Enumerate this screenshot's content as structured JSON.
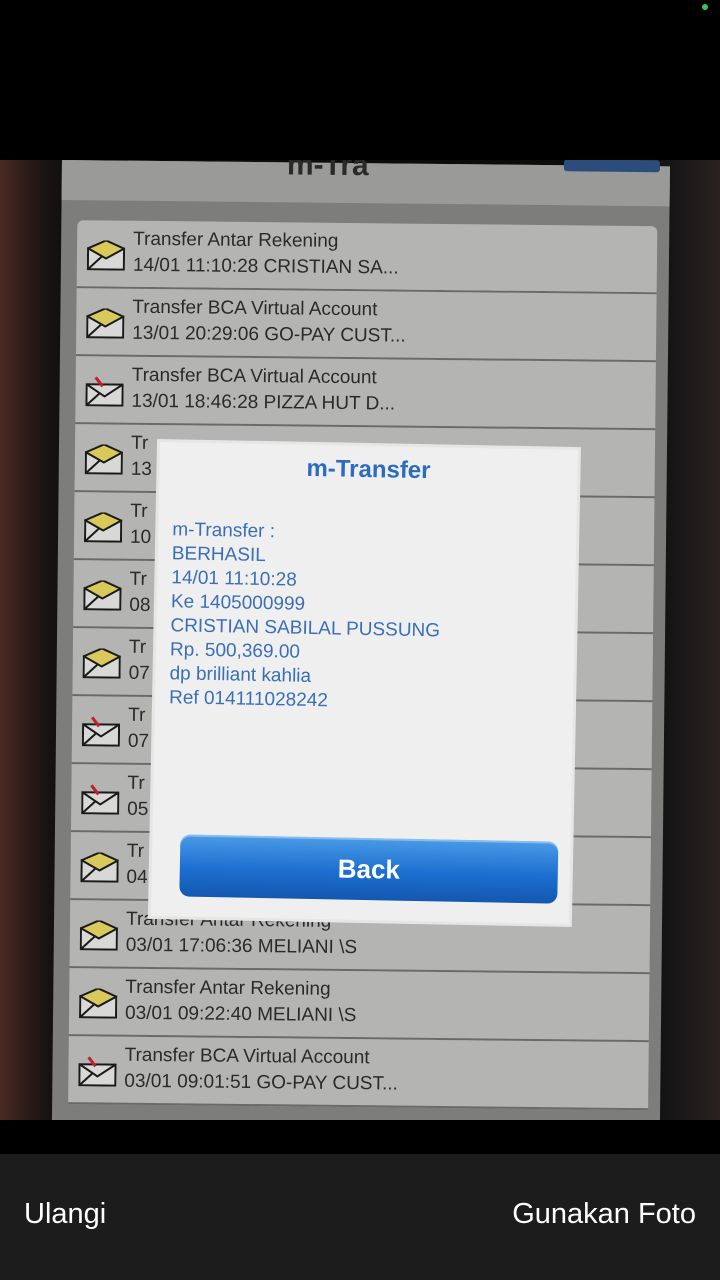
{
  "status": {
    "dot_color": "#34c759"
  },
  "photo": {
    "screen_header_title": "m-Tra",
    "messages": [
      {
        "title": "Transfer Antar Rekening",
        "subtitle": "14/01 11:10:28 CRISTIAN SA...",
        "icon": "envelope-closed-icon"
      },
      {
        "title": "Transfer BCA Virtual Account",
        "subtitle": "13/01 20:29:06 GO-PAY CUST...",
        "icon": "envelope-closed-icon"
      },
      {
        "title": "Transfer BCA Virtual Account",
        "subtitle": "13/01 18:46:28 PIZZA HUT D...",
        "icon": "envelope-open-icon"
      },
      {
        "title": "Tr",
        "subtitle": "13",
        "icon": "envelope-closed-icon"
      },
      {
        "title": "Tr",
        "subtitle": "10",
        "icon": "envelope-closed-icon"
      },
      {
        "title": "Tr",
        "subtitle": "08",
        "icon": "envelope-closed-icon"
      },
      {
        "title": "Tr",
        "subtitle": "07",
        "icon": "envelope-closed-icon"
      },
      {
        "title": "Tr",
        "subtitle": "07",
        "icon": "envelope-open-icon"
      },
      {
        "title": "Tr",
        "subtitle": "05",
        "icon": "envelope-open-icon"
      },
      {
        "title": "Tr",
        "subtitle": "04",
        "icon": "envelope-closed-icon"
      },
      {
        "title": "Transfer Antar Rekening",
        "subtitle": "03/01 17:06:36 MELIANI \\S",
        "icon": "envelope-closed-icon"
      },
      {
        "title": "Transfer Antar Rekening",
        "subtitle": "03/01 09:22:40 MELIANI \\S",
        "icon": "envelope-closed-icon"
      },
      {
        "title": "Transfer BCA Virtual Account",
        "subtitle": "03/01 09:01:51 GO-PAY CUST...",
        "icon": "envelope-open-icon"
      }
    ],
    "dialog": {
      "title": "m-Transfer",
      "lines": [
        "m-Transfer :",
        "BERHASIL",
        "14/01 11:10:28",
        "Ke 1405000999",
        "CRISTIAN SABILAL PUSSUNG",
        "Rp. 500,369.00",
        "dp brilliant kahlia",
        "Ref 014111028242"
      ],
      "back_label": "Back"
    }
  },
  "bottom": {
    "retake_label": "Ulangi",
    "use_photo_label": "Gunakan Foto"
  }
}
